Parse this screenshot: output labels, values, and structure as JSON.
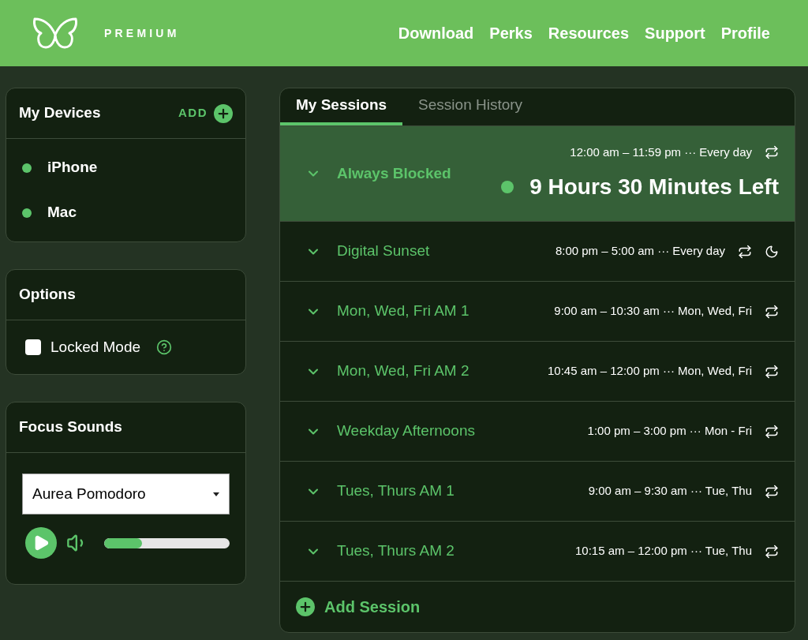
{
  "header": {
    "brand": "PREMIUM",
    "nav": [
      "Download",
      "Perks",
      "Resources",
      "Support",
      "Profile"
    ]
  },
  "devices": {
    "title": "My Devices",
    "add_label": "ADD",
    "items": [
      {
        "name": "iPhone",
        "color": "#5cc46a"
      },
      {
        "name": "Mac",
        "color": "#5cc46a"
      }
    ]
  },
  "options": {
    "title": "Options",
    "items": [
      {
        "label": "Locked Mode",
        "checked": false
      }
    ]
  },
  "focus_sounds": {
    "title": "Focus Sounds",
    "track": "Aurea Pomodoro",
    "volume": {
      "level": 0.3
    }
  },
  "tabs": [
    {
      "label": "My Sessions",
      "selected": true
    },
    {
      "label": "Session History",
      "selected": false
    }
  ],
  "sessions": [
    {
      "name": "Always Blocked",
      "schedule": "12:00 am – 11:59 pm ··· Every day",
      "active": true,
      "remaining": "9 Hours 30 Minutes Left",
      "night": false
    },
    {
      "name": "Digital Sunset",
      "schedule": "8:00 pm – 5:00 am ··· Every day",
      "active": false,
      "night": true
    },
    {
      "name": "Mon, Wed, Fri AM 1",
      "schedule": "9:00 am – 10:30 am ··· Mon, Wed, Fri",
      "active": false,
      "night": false
    },
    {
      "name": "Mon, Wed, Fri AM 2",
      "schedule": "10:45 am – 12:00 pm ··· Mon, Wed, Fri",
      "active": false,
      "night": false
    },
    {
      "name": "Weekday Afternoons",
      "schedule": "1:00 pm – 3:00 pm ··· Mon - Fri",
      "active": false,
      "night": false
    },
    {
      "name": "Tues, Thurs AM 1",
      "schedule": "9:00 am – 9:30 am ··· Tue, Thu",
      "active": false,
      "night": false
    },
    {
      "name": "Tues, Thurs AM 2",
      "schedule": "10:15 am – 12:00 pm ··· Tue, Thu",
      "active": false,
      "night": false
    }
  ],
  "add_session": "Add Session"
}
